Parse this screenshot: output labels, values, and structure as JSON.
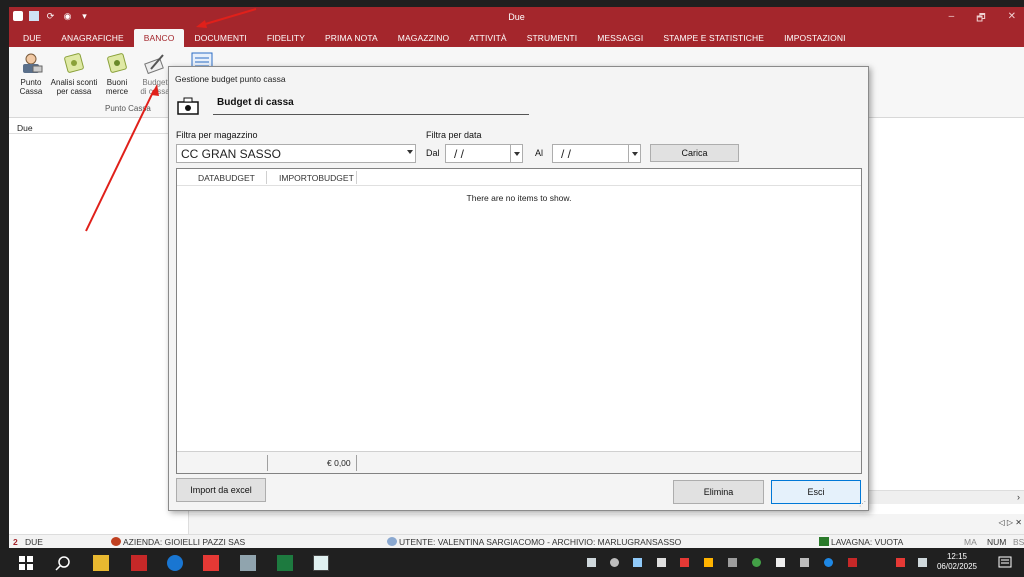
{
  "window": {
    "title": "Due",
    "quick_access": [
      "app-icon",
      "save-icon",
      "refresh-icon",
      "help-icon",
      "customize-icon"
    ],
    "controls": [
      "–",
      "🗗",
      "✕"
    ]
  },
  "ribbon": {
    "tabs": [
      "DUE",
      "ANAGRAFICHE",
      "BANCO",
      "DOCUMENTI",
      "FIDELITY",
      "PRIMA NOTA",
      "MAGAZZINO",
      "ATTIVITÀ",
      "STRUMENTI",
      "MESSAGGI",
      "STAMPE E STATISTICHE",
      "IMPOSTAZIONI"
    ],
    "active_tab": "BANCO",
    "buttons": [
      {
        "line1": "Punto",
        "line2": "Cassa"
      },
      {
        "line1": "Analisi sconti",
        "line2": "per cassa"
      },
      {
        "line1": "Buoni",
        "line2": "merce"
      },
      {
        "line1": "Budget",
        "line2": "di cassa"
      }
    ],
    "group_label": "Punto Cassa"
  },
  "left_panel": {
    "header": "Due"
  },
  "dialog": {
    "title": "Gestione budget punto cassa",
    "heading": "Budget di cassa",
    "filter_store_label": "Filtra per magazzino",
    "store_value": "CC GRAN SASSO",
    "filter_date_label": "Filtra per data",
    "from_label": "Dal",
    "from_value": "/ /",
    "to_label": "Al",
    "to_value": "/ /",
    "load_button": "Carica",
    "columns": [
      "DATABUDGET",
      "IMPORTOBUDGET"
    ],
    "empty_message": "There are no items to show.",
    "total": "€ 0,00",
    "import_button": "Import da excel",
    "delete_button": "Elimina",
    "exit_button": "Esci"
  },
  "status_bar": {
    "count": "2",
    "app": "DUE",
    "company": "AZIENDA: GIOIELLI PAZZI SAS",
    "user": "UTENTE: VALENTINA SARGIACOMO - ARCHIVIO: MARLUGRANSASSO",
    "board": "LAVAGNA: VUOTA",
    "ma": "MA",
    "num": "NUM",
    "bs": "BS"
  },
  "bottom_nav": "◁ ▷ ✕",
  "taskbar": {
    "time": "12:15",
    "date": "06/02/2025"
  },
  "colors": {
    "accent": "#a4262c",
    "annotation_arrow": "#e0201a"
  }
}
